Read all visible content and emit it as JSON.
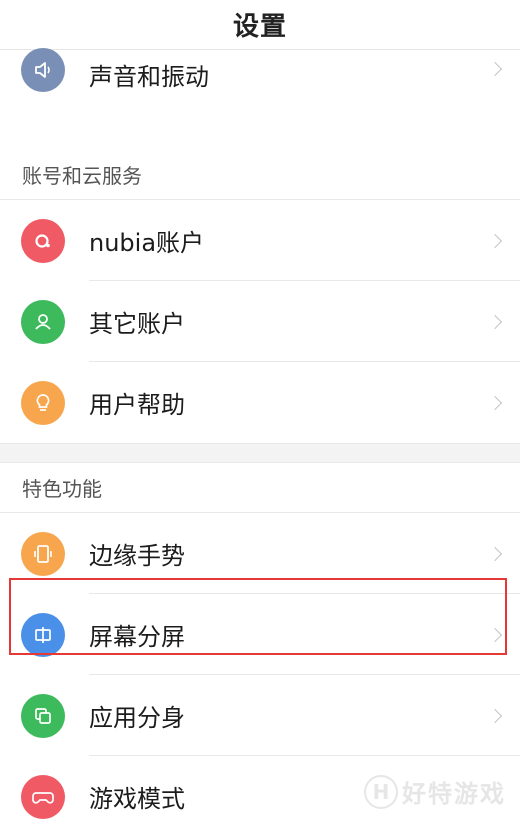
{
  "header": {
    "title": "设置"
  },
  "top_item": {
    "label": "声音和振动",
    "icon": "speaker-icon",
    "color": "#7a8fb6"
  },
  "account_section": {
    "title": "账号和云服务",
    "items": [
      {
        "label": "nubia账户",
        "icon": "nubia-account-icon",
        "color": "#ef5a64"
      },
      {
        "label": "其它账户",
        "icon": "person-icon",
        "color": "#3cba5c"
      },
      {
        "label": "用户帮助",
        "icon": "lightbulb-icon",
        "color": "#f8a64e"
      }
    ]
  },
  "feature_section": {
    "title": "特色功能",
    "items": [
      {
        "label": "边缘手势",
        "icon": "edge-gesture-icon",
        "color": "#f8a64e"
      },
      {
        "label": "屏幕分屏",
        "icon": "split-screen-icon",
        "color": "#4a90e8"
      },
      {
        "label": "应用分身",
        "icon": "app-clone-icon",
        "color": "#3cba5c"
      },
      {
        "label": "游戏模式",
        "icon": "gamepad-icon",
        "color": "#ef5a64"
      }
    ]
  },
  "highlight_color": "#e53935",
  "watermark": {
    "text": "好特游戏",
    "badge": "H"
  }
}
